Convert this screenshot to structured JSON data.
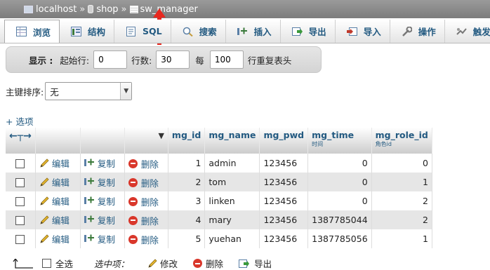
{
  "breadcrumb": {
    "server": "localhost",
    "database": "shop",
    "table": "sw_manager",
    "separator": "»"
  },
  "tabs": [
    {
      "label": "浏览",
      "icon": "browse-icon"
    },
    {
      "label": "结构",
      "icon": "structure-icon"
    },
    {
      "label": "SQL",
      "icon": "sql-icon"
    },
    {
      "label": "搜索",
      "icon": "search-icon"
    },
    {
      "label": "插入",
      "icon": "insert-icon"
    },
    {
      "label": "导出",
      "icon": "export-icon"
    },
    {
      "label": "导入",
      "icon": "import-icon"
    },
    {
      "label": "操作",
      "icon": "operations-icon"
    },
    {
      "label": "触发器",
      "icon": "triggers-icon"
    }
  ],
  "display": {
    "label": "显示 :",
    "start_label": "起始行:",
    "start_value": "0",
    "rows_label": "行数:",
    "rows_value": "30",
    "per_label": "每",
    "per_value": "100",
    "repeat_label": "行重复表头"
  },
  "sort": {
    "label": "主键排序:",
    "selected": "无"
  },
  "options_link": "+ 选项",
  "columns": [
    {
      "name": "mg_id",
      "comment": ""
    },
    {
      "name": "mg_name",
      "comment": ""
    },
    {
      "name": "mg_pwd",
      "comment": ""
    },
    {
      "name": "mg_time",
      "comment": "时间"
    },
    {
      "name": "mg_role_id",
      "comment": "角色id"
    }
  ],
  "row_actions": {
    "edit": "编辑",
    "copy": "复制",
    "delete": "删除"
  },
  "rows": [
    {
      "mg_id": "1",
      "mg_name": "admin",
      "mg_pwd": "123456",
      "mg_time": "0",
      "mg_role_id": "0"
    },
    {
      "mg_id": "2",
      "mg_name": "tom",
      "mg_pwd": "123456",
      "mg_time": "0",
      "mg_role_id": "1"
    },
    {
      "mg_id": "3",
      "mg_name": "linken",
      "mg_pwd": "123456",
      "mg_time": "0",
      "mg_role_id": "2"
    },
    {
      "mg_id": "4",
      "mg_name": "mary",
      "mg_pwd": "123456",
      "mg_time": "1387785044",
      "mg_role_id": "2"
    },
    {
      "mg_id": "5",
      "mg_name": "yuehan",
      "mg_pwd": "123456",
      "mg_time": "1387785056",
      "mg_role_id": "1"
    }
  ],
  "bottom": {
    "select_all": "全选",
    "with_selected": "选中项：",
    "edit": "修改",
    "delete": "删除",
    "export": "导出"
  },
  "colors": {
    "link": "#235a81",
    "annotation_arrow": "#e8281f",
    "delete_icon": "#d9372b"
  }
}
